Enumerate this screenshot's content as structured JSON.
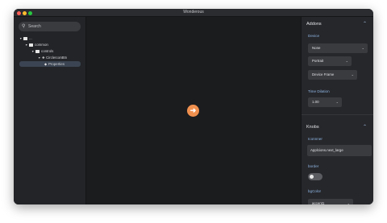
{
  "window": {
    "title": "Wonderous"
  },
  "sidebar": {
    "search_placeholder": "Search",
    "tree": [
      {
        "label": "..."
      },
      {
        "label": "common"
      },
      {
        "label": "controls"
      },
      {
        "label": "CircleIconBtn"
      },
      {
        "label": "Properties"
      }
    ]
  },
  "canvas": {
    "button_icon": "arrow-right-icon"
  },
  "addons": {
    "title": "Addons",
    "device_label": "Device",
    "device_value": "None",
    "orientation_value": "Portrait",
    "frame_value": "Device Frame",
    "time_dilation_label": "Time Dilation",
    "time_dilation_value": "1.00"
  },
  "knobs": {
    "title": "Knobs",
    "icon_label": "Iconnner",
    "icon_value": "Applcions.next_large",
    "border_label": "border",
    "bgcolor_label": "bgColor",
    "bgcolor_value": "accent1"
  },
  "colors": {
    "accent": "#8fb6e3",
    "orb": "#f0904f"
  }
}
